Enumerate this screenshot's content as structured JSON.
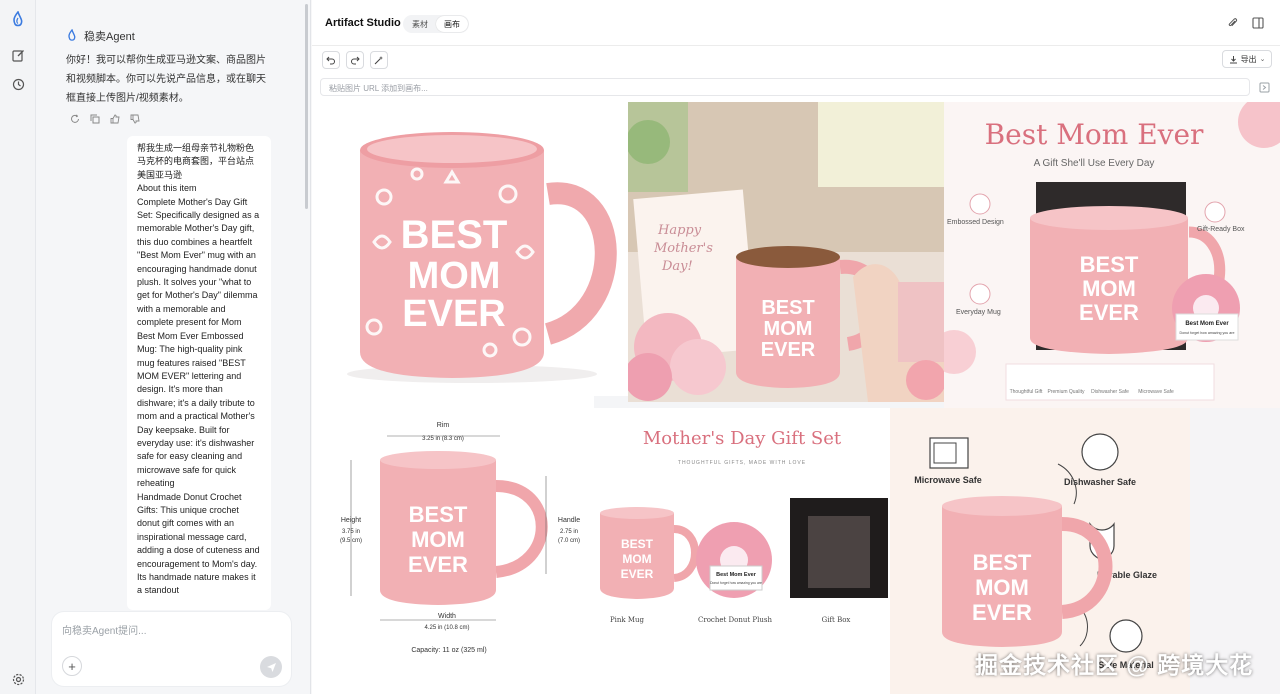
{
  "chat": {
    "agent_name": "稳卖Agent",
    "greeting": "你好！我可以帮你生成亚马逊文案、商品图片和视频脚本。你可以先说产品信息，或在聊天框直接上传图片/视频素材。",
    "user_message": [
      "帮我生成一组母亲节礼物粉色马克杯的电商套图，平台站点美国亚马逊",
      "About this item",
      "Complete Mother's Day Gift Set: Specifically designed as a memorable Mother's Day gift, this duo combines a heartfelt \"Best Mom Ever\" mug with an encouraging handmade donut plush. It solves your \"what to get for Mother's Day\" dilemma with a memorable and complete present for Mom",
      "Best Mom Ever Embossed Mug: The high-quality pink mug features raised \"BEST MOM EVER\" lettering and design. It's more than dishware; it's a daily tribute to mom and a practical Mother's Day keepsake. Built for everyday use: it's dishwasher safe for easy cleaning and microwave safe for quick reheating",
      "Handmade Donut Crochet Gifts: This unique crochet donut gift comes with an inspirational message card, adding a dose of cuteness and encouragement to Mom's day. Its handmade nature makes it a standout"
    ],
    "input_placeholder": "向稳卖Agent提问..."
  },
  "studio": {
    "title": "Artifact Studio",
    "tabs": [
      "素材",
      "画布"
    ],
    "active_tab": "画布",
    "export_label": "导出",
    "url_placeholder": "粘贴图片 URL 添加到画布..."
  },
  "canvas": {
    "tile1": {
      "mug_text": [
        "BEST",
        "MOM",
        "EVER"
      ]
    },
    "tile2": {
      "card_text": [
        "Happy",
        "Mother's",
        "Day!"
      ],
      "mug_text": [
        "BEST",
        "MOM",
        "EVER"
      ]
    },
    "tile3": {
      "title": "Best Mom Ever",
      "subtitle": "A Gift She'll Use Every Day",
      "callouts": [
        "Embossed Design",
        "Gift-Ready Box",
        "Everyday Mug"
      ],
      "features": [
        "Thoughtful Gift",
        "Premium Quality",
        "Dishwasher Safe",
        "Microwave Safe"
      ],
      "plush_card": [
        "Best Mom Ever",
        "Donut forget how amazing you are"
      ],
      "mug_text": [
        "BEST",
        "MOM",
        "EVER"
      ]
    },
    "tile4": {
      "rim_label": "Rim",
      "rim_value": "3.25 in (8.3 cm)",
      "height_label": "Height",
      "height_value": [
        "3.75 in",
        "(9.5 cm)"
      ],
      "handle_label": "Handle",
      "handle_value": [
        "2.75 in",
        "(7.0 cm)"
      ],
      "width_label": "Width",
      "width_value": "4.25 in (10.8 cm)",
      "capacity": "Capacity: 11 oz (325 ml)",
      "mug_text": [
        "BEST",
        "MOM",
        "EVER"
      ]
    },
    "tile5": {
      "title": "Mother's Day Gift Set",
      "subtitle": "THOUGHTFUL GIFTS, MADE WITH LOVE",
      "items": [
        "Pink Mug",
        "Crochet Donut Plush",
        "Gift Box"
      ],
      "plush_card": [
        "Best Mom Ever",
        "Donut forget how amazing you are"
      ],
      "mug_text": [
        "BEST",
        "MOM",
        "EVER"
      ]
    },
    "tile6": {
      "features": [
        "Microwave Safe",
        "Dishwasher Safe",
        "Durable Glaze",
        "Safe Material"
      ],
      "mug_text": [
        "BEST",
        "MOM",
        "EVER"
      ]
    }
  },
  "watermark": "掘金技术社区 @ 跨境大花",
  "icons": [
    "logo-icon",
    "new-chat-icon",
    "history-icon",
    "settings-icon",
    "refresh-icon",
    "copy-icon",
    "thumb-up-icon",
    "thumb-down-icon",
    "plus-icon",
    "send-icon",
    "undo-icon",
    "redo-icon",
    "magic-icon",
    "attach-icon",
    "panel-icon",
    "download-icon",
    "add-image-icon"
  ],
  "colors": {
    "mug_pink": "#f2b0b4",
    "title_pink": "#d9707e",
    "accent": "#3b7be0"
  }
}
